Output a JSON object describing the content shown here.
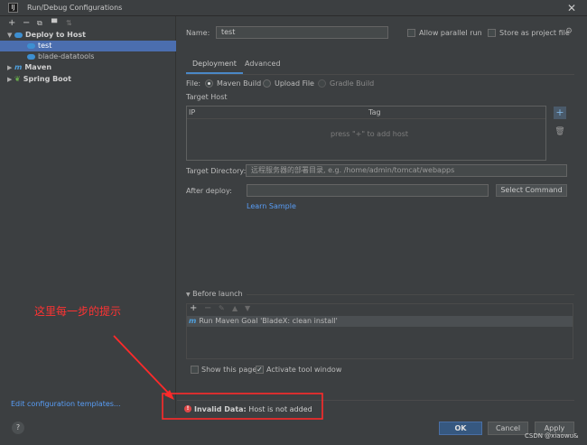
{
  "window": {
    "title": "Run/Debug Configurations",
    "app_icon_letter": "IJ",
    "close_glyph": "✕"
  },
  "toolbar": {
    "add": "+",
    "remove": "−",
    "copy": "⧉",
    "folder": "▀",
    "sort": "⇅"
  },
  "tree": {
    "items": [
      {
        "label": "Deploy to Host",
        "icon": "cloud-icon",
        "expanded": true
      },
      {
        "label": "test",
        "icon": "cloud-icon",
        "selected": true
      },
      {
        "label": "blade-datatools",
        "icon": "cloud-icon"
      },
      {
        "label": "Maven",
        "icon": "maven-icon",
        "expanded": false
      },
      {
        "label": "Spring Boot",
        "icon": "spring-boot-icon",
        "expanded": false
      }
    ]
  },
  "edit_templates_link": "Edit configuration templates...",
  "help_glyph": "?",
  "form": {
    "name_label": "Name:",
    "name_value": "test",
    "allow_parallel_label": "Allow parallel run",
    "store_project_label": "Store as project file",
    "tabs": [
      "Deployment",
      "Advanced"
    ],
    "file_label": "File:",
    "file_options": [
      "Maven Build",
      "Upload File",
      "Gradle Build"
    ],
    "target_host_label": "Target Host",
    "table_columns": [
      "IP",
      "Tag"
    ],
    "table_empty_text": "press \"+\" to add host",
    "target_dir_label": "Target Directory:",
    "target_dir_placeholder": "远程服务器的部署目录, e.g. /home/admin/tomcat/webapps",
    "after_deploy_label": "After deploy:",
    "after_deploy_value": "",
    "select_command_label": "Select Command",
    "learn_sample_link": "Learn Sample"
  },
  "before_launch": {
    "header": "Before launch",
    "tasks": [
      "Run Maven Goal 'BladeX: clean install'"
    ],
    "show_page_label": "Show this page",
    "activate_tool_window_label": "Activate tool window",
    "show_page_checked": false,
    "activate_tool_window_checked": true
  },
  "validation": {
    "error_prefix": "Invalid Data:",
    "error_message": "Host is not added"
  },
  "buttons": {
    "ok": "OK",
    "cancel": "Cancel",
    "apply": "Apply"
  },
  "annotation": {
    "text": "这里每一步的提示",
    "color": "#ff3333"
  },
  "watermark": "CSDN @xiaowu&"
}
